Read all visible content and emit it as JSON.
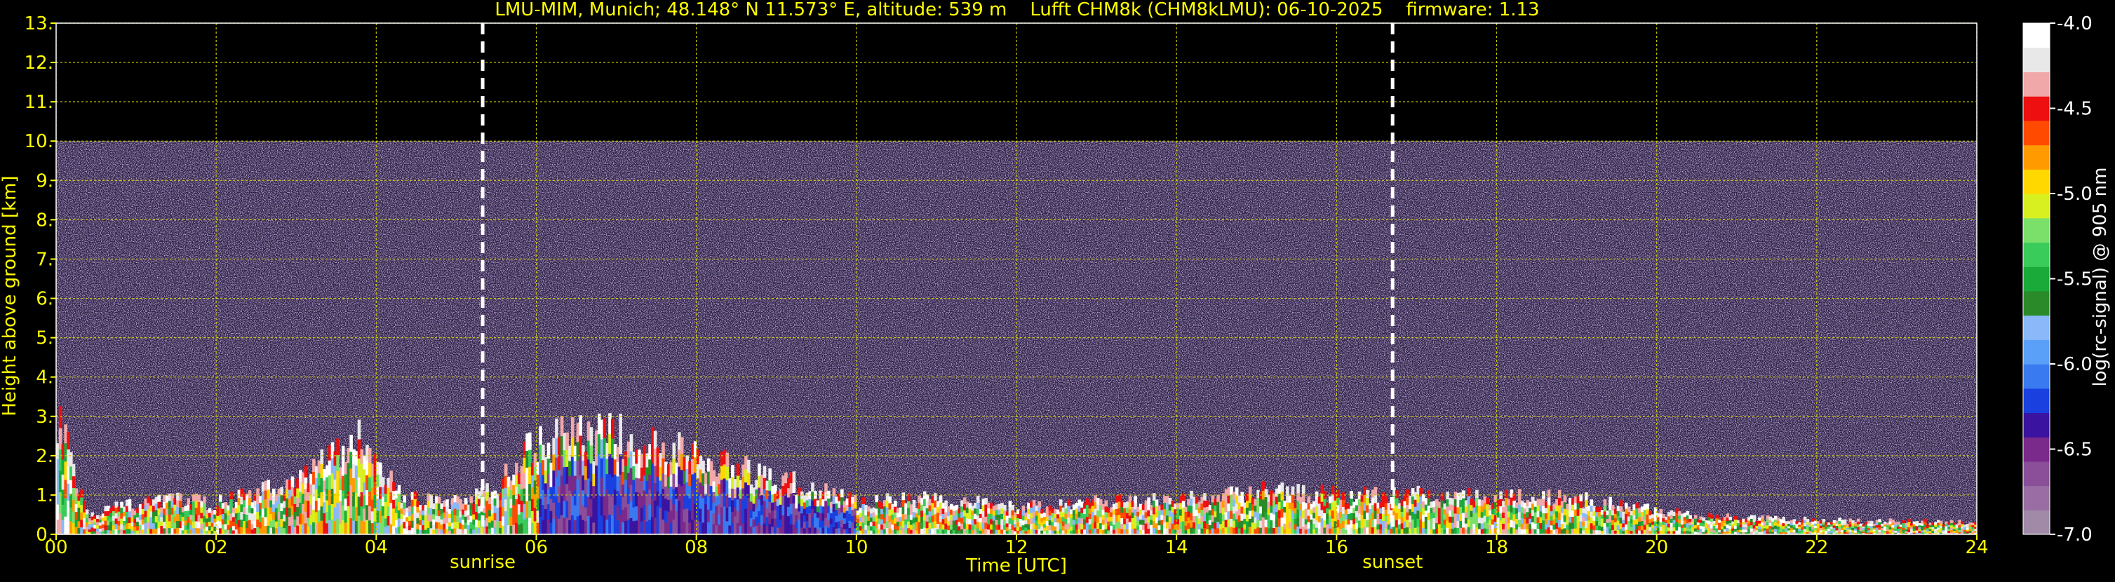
{
  "chart_data": {
    "type": "heatmap",
    "title": "LMU-MIM, Munich; 48.148° N 11.573° E, altitude: 539 m    Lufft CHM8k (CHM8kLMU): 06-10-2025    firmware: 1.13",
    "xlabel": "Time [UTC]",
    "ylabel": "Height above ground [km]",
    "colorbar_label": "log(rc-signal) @ 905 nm",
    "xlim": [
      0,
      24
    ],
    "ylim": [
      0,
      13
    ],
    "x_ticks": [
      0,
      2,
      4,
      6,
      8,
      10,
      12,
      14,
      16,
      18,
      20,
      22,
      24
    ],
    "x_tick_labels": [
      "00",
      "02",
      "04",
      "06",
      "08",
      "10",
      "12",
      "14",
      "16",
      "18",
      "20",
      "22",
      "24"
    ],
    "y_ticks": [
      0,
      1,
      2,
      3,
      4,
      5,
      6,
      7,
      8,
      9,
      10,
      11,
      12,
      13
    ],
    "y_tick_labels": [
      "0.",
      "1.",
      "2.",
      "3.",
      "4.",
      "5.",
      "6.",
      "7.",
      "8.",
      "9.",
      "10.",
      "11.",
      "12.",
      "13."
    ],
    "colorbar_range": [
      -7.0,
      -4.0
    ],
    "colorbar_ticks": [
      -4.0,
      -4.5,
      -5.0,
      -5.5,
      -6.0,
      -6.5,
      -7.0
    ],
    "colorbar_tick_labels": [
      "-4.0",
      "-4.5",
      "-5.0",
      "-5.5",
      "-6.0",
      "-6.5",
      "-7.0"
    ],
    "colormap": [
      "#a08aa8",
      "#9a6ea4",
      "#8a4f98",
      "#7a2a8a",
      "#3a14a0",
      "#1a40e0",
      "#3a7af0",
      "#5aa0f8",
      "#8ab8f8",
      "#2a8a2a",
      "#1aaa3a",
      "#3acc5a",
      "#7ae06a",
      "#d8f020",
      "#ffd800",
      "#ff9a00",
      "#ff4a00",
      "#ee1010",
      "#f0a8a8",
      "#e8e8e8",
      "#ffffff"
    ],
    "data_max_height_km": 10,
    "grid": true,
    "grid_color": "#cccc00",
    "text_color": "#ffff00",
    "events": [
      {
        "label": "sunrise",
        "time": 5.33
      },
      {
        "label": "sunset",
        "time": 16.7
      }
    ],
    "cloud_top_km": [
      [
        0.0,
        2.9
      ],
      [
        0.4,
        0.5
      ],
      [
        1.2,
        0.9
      ],
      [
        2.0,
        0.8
      ],
      [
        3.0,
        1.3
      ],
      [
        3.8,
        2.5
      ],
      [
        4.3,
        0.9
      ],
      [
        5.0,
        0.8
      ],
      [
        5.5,
        1.3
      ],
      [
        6.0,
        2.4
      ],
      [
        7.0,
        2.5
      ],
      [
        8.0,
        2.1
      ],
      [
        8.5,
        1.7
      ],
      [
        9.0,
        1.4
      ],
      [
        9.5,
        1.1
      ],
      [
        10.0,
        0.8
      ],
      [
        11.0,
        0.9
      ],
      [
        12.0,
        0.7
      ],
      [
        13.0,
        0.8
      ],
      [
        14.0,
        0.9
      ],
      [
        15.0,
        1.1
      ],
      [
        16.0,
        1.0
      ],
      [
        17.0,
        1.0
      ],
      [
        18.0,
        0.95
      ],
      [
        19.0,
        0.9
      ],
      [
        20.0,
        0.6
      ],
      [
        20.5,
        0.45
      ],
      [
        22.0,
        0.35
      ],
      [
        24.0,
        0.3
      ]
    ]
  }
}
